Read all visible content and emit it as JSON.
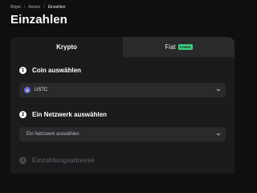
{
  "breadcrumb": {
    "items": [
      "Bitget",
      "Assets",
      "Einzahlen"
    ],
    "separator": "/"
  },
  "page_title": "Einzahlen",
  "tabs": {
    "krypto": "Krypto",
    "fiat": "Fiat",
    "fiat_badge": "0 FEES"
  },
  "steps": [
    {
      "number": "1",
      "title": "Coin auswählen"
    },
    {
      "number": "2",
      "title": "Ein Netzwerk auswählen"
    },
    {
      "number": "3",
      "title": "Einzahlungsadresse"
    }
  ],
  "coin_select": {
    "value": "USTC",
    "icon": "ustc-coin-icon"
  },
  "network_select": {
    "placeholder": "Ein Netzwerk auswählen"
  },
  "colors": {
    "background": "#0f0f10",
    "card": "#1b1b1d",
    "input": "#2a2a2d",
    "badge": "#3fd07a",
    "coin": "#5b6cf5"
  }
}
